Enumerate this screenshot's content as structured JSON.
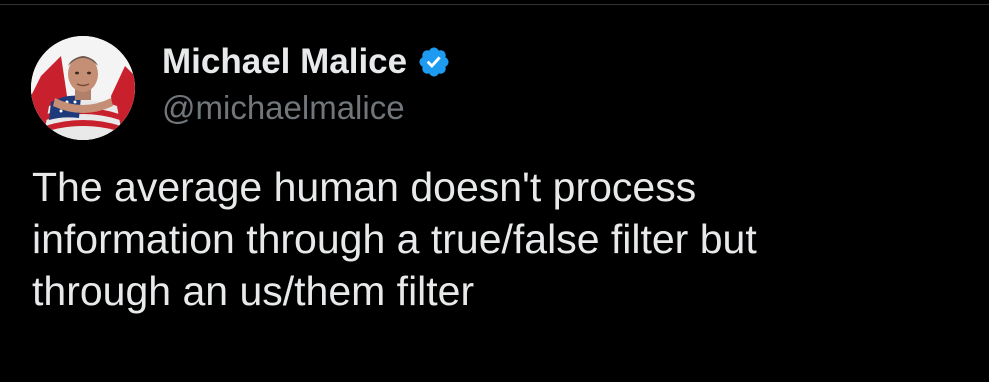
{
  "tweet": {
    "author": {
      "display_name": "Michael Malice",
      "handle": "@michaelmalice",
      "verified": true,
      "avatar": "avatar-photo"
    },
    "text": "The average human doesn't process\ninformation through a true/false filter but\nthrough an us/them filter"
  },
  "colors": {
    "background": "#000000",
    "text": "#e7e9ea",
    "secondary_text": "#71767b",
    "verified_badge": "#1d9bf0"
  },
  "icons": {
    "verified": "verified-badge-icon"
  }
}
